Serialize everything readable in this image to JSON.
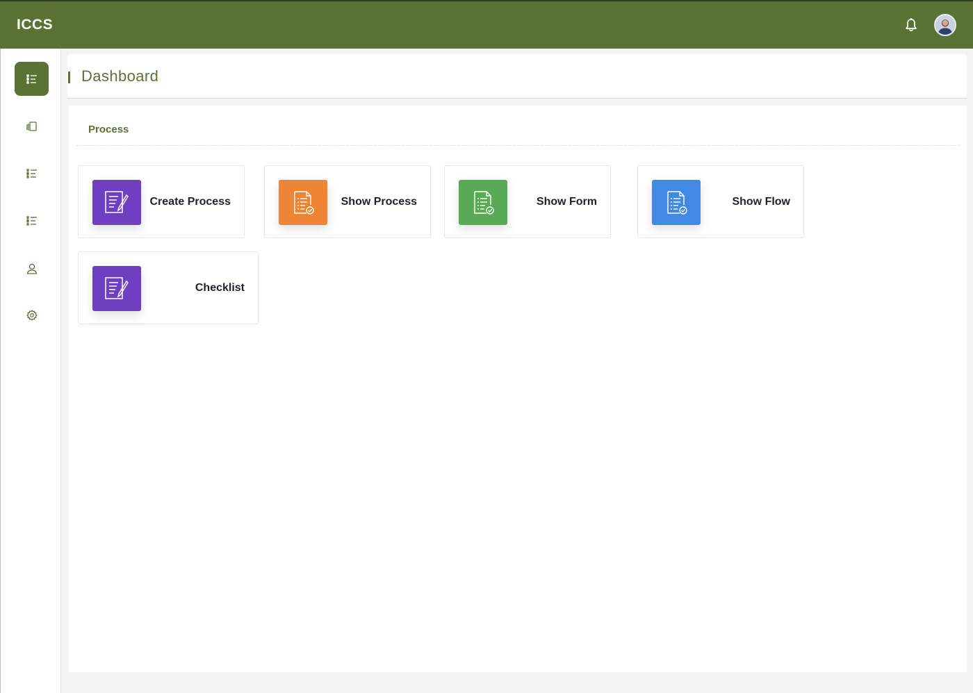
{
  "app": {
    "title": "ICCS"
  },
  "topbar": {
    "notification_icon": "bell-icon",
    "avatar_icon": "user-avatar"
  },
  "sidebar": {
    "items": [
      {
        "name": "list-icon",
        "active": true
      },
      {
        "name": "documents-icon",
        "active": false
      },
      {
        "name": "list-icon",
        "active": false
      },
      {
        "name": "list-icon",
        "active": false
      },
      {
        "name": "user-icon",
        "active": false
      },
      {
        "name": "gear-icon",
        "active": false
      }
    ]
  },
  "page": {
    "title": "Dashboard"
  },
  "section": {
    "title": "Process",
    "tiles": [
      {
        "label": "Create Process",
        "icon": "edit-document-icon",
        "color": "#6f3fc1"
      },
      {
        "label": "Show Process",
        "icon": "checklist-document-icon",
        "color": "#ef8533"
      },
      {
        "label": "Show Form",
        "icon": "checklist-document-icon",
        "color": "#5aa955"
      },
      {
        "label": "Show Flow",
        "icon": "checklist-document-icon",
        "color": "#4289e6"
      },
      {
        "label": "Checklist",
        "icon": "edit-document-icon",
        "color": "#6f3fc1"
      }
    ]
  },
  "colors": {
    "brand": "#5a7335",
    "accent_text": "#1d2230"
  }
}
